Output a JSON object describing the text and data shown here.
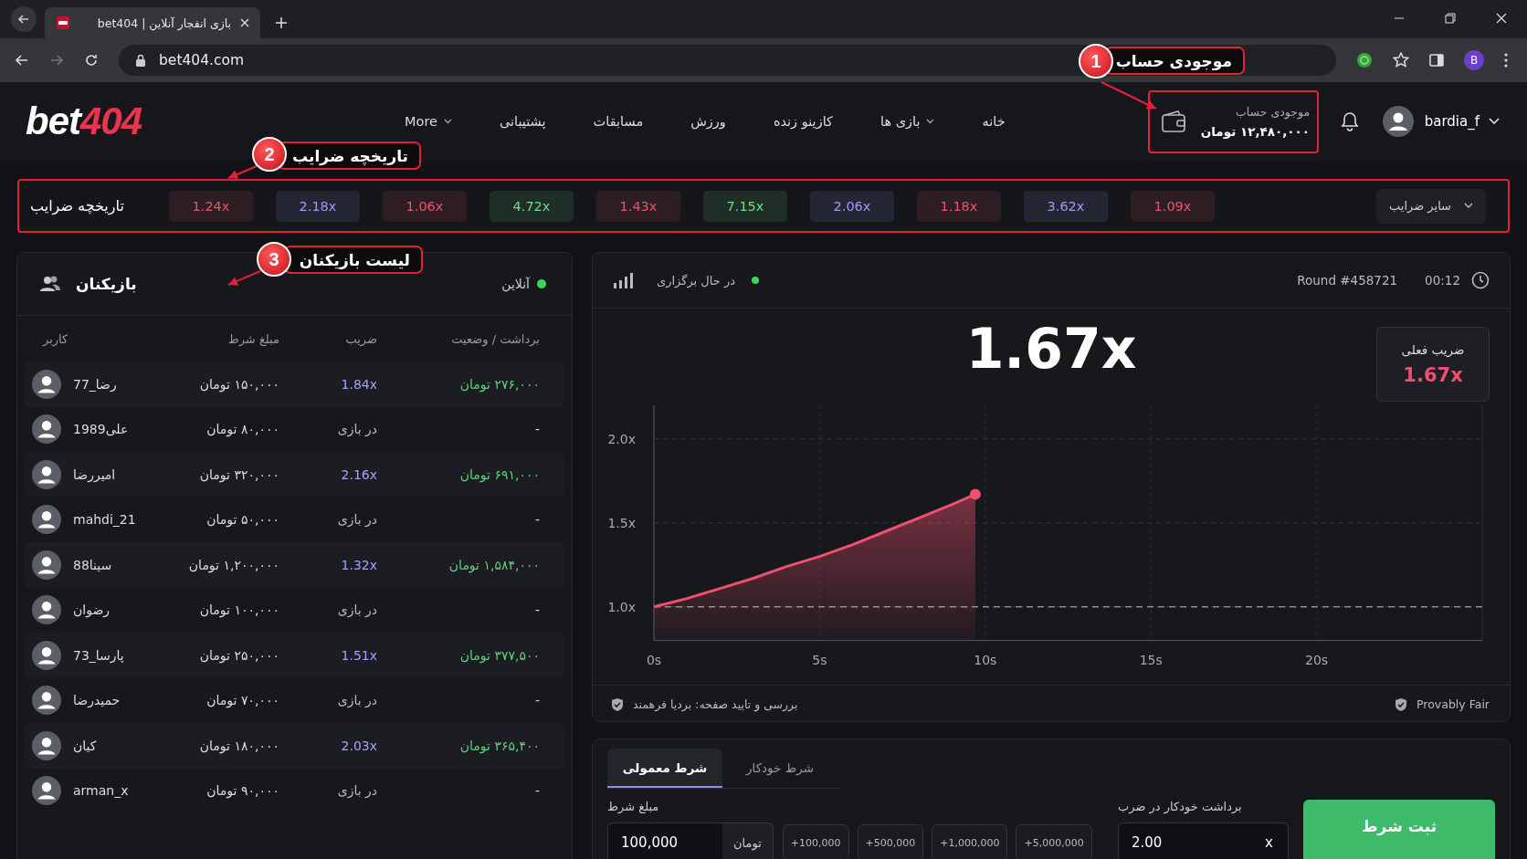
{
  "browser": {
    "tab": {
      "title": "بازی انفجار آنلاین | bet404",
      "selected": true
    },
    "url": "bet404.com",
    "profile_initial": "B"
  },
  "header": {
    "logo": {
      "main": "bet",
      "accent": "404"
    },
    "nav": [
      {
        "label": "خانه",
        "dropdown": false
      },
      {
        "label": "بازی ها",
        "dropdown": true
      },
      {
        "label": "کازینو زنده",
        "dropdown": false
      },
      {
        "label": "ورزش",
        "dropdown": false
      },
      {
        "label": "مسابقات",
        "dropdown": false
      },
      {
        "label": "پشتیبانی",
        "dropdown": false
      },
      {
        "label": "More",
        "dropdown": true
      }
    ],
    "balance": {
      "label": "موجودی حساب",
      "amount": "۱۲,۴۸۰,۰۰۰ تومان",
      "highlighted": true
    },
    "user": {
      "name": "bardia_f"
    }
  },
  "history": {
    "title": "تاریخچه ضرایب",
    "highlighted": true,
    "more": "سایر ضرایب",
    "multipliers": [
      {
        "value": "1.09x",
        "color": "#e8566b"
      },
      {
        "value": "3.62x",
        "color": "#9d9cf6"
      },
      {
        "value": "1.18x",
        "color": "#e8566b"
      },
      {
        "value": "2.06x",
        "color": "#9d9cf6"
      },
      {
        "value": "7.15x",
        "color": "#6fdc8c"
      },
      {
        "value": "1.43x",
        "color": "#e8566b"
      },
      {
        "value": "4.72x",
        "color": "#6fdc8c"
      },
      {
        "value": "1.06x",
        "color": "#e8566b"
      },
      {
        "value": "2.18x",
        "color": "#9d9cf6"
      },
      {
        "value": "1.24x",
        "color": "#e8566b"
      }
    ]
  },
  "players": {
    "title": "بازیکنان",
    "status": "آنلاین",
    "columns": [
      "برداشت / وضعیت",
      "ضریب",
      "مبلغ شرط",
      "کاربر"
    ],
    "rows": [
      {
        "user": "رضا_77",
        "bet": "۱۵۰,۰۰۰ تومان",
        "kind": "cashed",
        "multiplier": "1.84x",
        "payout": "۲۷۶,۰۰۰ تومان"
      },
      {
        "user": "علی1989",
        "bet": "۸۰,۰۰۰ تومان",
        "kind": "playing",
        "multiplier": "در بازی",
        "payout": "-"
      },
      {
        "user": "امیررضا",
        "bet": "۳۲۰,۰۰۰ تومان",
        "kind": "cashed",
        "multiplier": "2.16x",
        "payout": "۶۹۱,۰۰۰ تومان"
      },
      {
        "user": "mahdi_21",
        "bet": "۵۰,۰۰۰ تومان",
        "kind": "playing",
        "multiplier": "در بازی",
        "payout": "-"
      },
      {
        "user": "سینا88",
        "bet": "۱,۲۰۰,۰۰۰ تومان",
        "kind": "cashed",
        "multiplier": "1.32x",
        "payout": "۱,۵۸۴,۰۰۰ تومان"
      },
      {
        "user": "رضوان",
        "bet": "۱۰۰,۰۰۰ تومان",
        "kind": "playing",
        "multiplier": "در بازی",
        "payout": "-"
      },
      {
        "user": "پارسا_73",
        "bet": "۲۵۰,۰۰۰ تومان",
        "kind": "cashed",
        "multiplier": "1.51x",
        "payout": "۳۷۷,۵۰۰ تومان"
      },
      {
        "user": "حمیدرضا",
        "bet": "۷۰,۰۰۰ تومان",
        "kind": "playing",
        "multiplier": "در بازی",
        "payout": "-"
      },
      {
        "user": "کیان",
        "bet": "۱۸۰,۰۰۰ تومان",
        "kind": "cashed",
        "multiplier": "2.03x",
        "payout": "۳۶۵,۴۰۰ تومان"
      },
      {
        "user": "arman_x",
        "bet": "۹۰,۰۰۰ تومان",
        "kind": "playing",
        "multiplier": "در بازی",
        "payout": "-"
      }
    ]
  },
  "game": {
    "status": "در حال برگزاری",
    "round": "Round #458721",
    "timer": "00:12",
    "multiplier": "1.67x",
    "current": {
      "label": "ضریب فعلی",
      "value": "1.67x"
    },
    "chart_data": {
      "type": "line",
      "x": [
        0,
        1,
        2,
        3,
        4,
        5,
        6,
        7,
        8,
        9,
        9.7
      ],
      "series": [
        {
          "color": "#f0506e",
          "values": [
            1.0,
            1.05,
            1.11,
            1.17,
            1.24,
            1.3,
            1.37,
            1.45,
            1.53,
            1.61,
            1.67
          ]
        }
      ],
      "xlim": [
        0,
        25
      ],
      "ylim": [
        0.8,
        2.2
      ],
      "grid": true,
      "ref_lines": [
        {
          "axis": "y",
          "value": 1.0
        }
      ],
      "xticks": [
        {
          "value": 0,
          "label": "0s"
        },
        {
          "value": 5,
          "label": "5s"
        },
        {
          "value": 10,
          "label": "10s"
        },
        {
          "value": 15,
          "label": "15s"
        },
        {
          "value": 20,
          "label": "20s"
        }
      ],
      "yticks": [
        {
          "value": 1,
          "label": "1.0x"
        },
        {
          "value": 1.5,
          "label": "1.5x"
        },
        {
          "value": 2,
          "label": "2.0x"
        }
      ]
    },
    "verified": "بررسی و تایید صفحه: بردیا فرهمند",
    "provably_fair": "Provably Fair"
  },
  "bet": {
    "tabs": [
      {
        "label": "شرط خودکار",
        "selected": false
      },
      {
        "label": "شرط معمولی",
        "selected": true
      }
    ],
    "amount": {
      "label": "مبلغ شرط",
      "value": "100,000",
      "currency": "تومان"
    },
    "quick_adds": [
      "+5,000,000",
      "+1,000,000",
      "+500,000",
      "+100,000"
    ],
    "auto_cashout": {
      "label": "برداشت خودکار در ضرب",
      "value": "2.00",
      "suffix": "x"
    },
    "submit": "ثبت شرط"
  },
  "annotations": [
    {
      "number": "1",
      "label": "موجودی حساب"
    },
    {
      "number": "2",
      "label": "تاریخچه ضرایب"
    },
    {
      "number": "3",
      "label": "لیست بازیکنان"
    }
  ]
}
